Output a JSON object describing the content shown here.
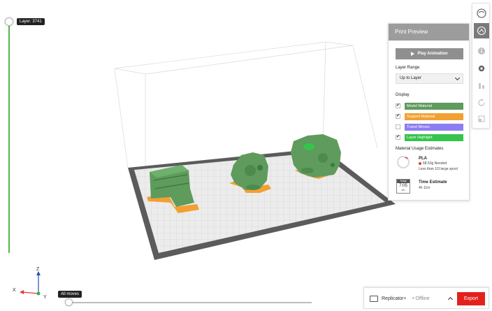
{
  "layer_slider": {
    "tooltip": "Layer: 3741"
  },
  "moves_slider": {
    "tooltip": "All moves"
  },
  "axes": {
    "x": "X",
    "y": "Y",
    "z": "Z"
  },
  "toolbar": {
    "icons": [
      "view-cube-icon",
      "print-preview-icon",
      "info-icon",
      "settings-gear-icon",
      "supports-icon",
      "refresh-icon",
      "layout-icon"
    ]
  },
  "panel": {
    "title": "Print Preview",
    "play_label": "Play Animation",
    "layer_range_title": "Layer Range",
    "layer_range_value": "Up to Layer",
    "display_title": "Display",
    "display_items": [
      {
        "label": "Model Material",
        "checked": "✔",
        "color": "#5e9b5c"
      },
      {
        "label": "Support Material",
        "checked": "✔",
        "color": "#f2a032"
      },
      {
        "label": "Travel Moves",
        "checked": "",
        "color": "#8c7ef0"
      },
      {
        "label": "Layer Highlight",
        "checked": "✔",
        "color": "#35c44c"
      }
    ],
    "material_title": "Material Usage Estimates",
    "material_name": "PLA",
    "material_needed": "68.53g  Needed",
    "material_note": "Less than 1/3 large spool",
    "calendar_header": "Today",
    "calendar_time": "7:05",
    "calendar_ampm": "am",
    "time_title": "Time Estimate",
    "time_value": "4h 11m"
  },
  "bottom_bar": {
    "printer_name": "Replicator+",
    "printer_status": "• Offline",
    "export_label": "Export"
  },
  "colors": {
    "model": "#5e9b5c",
    "support": "#f2a032",
    "travel": "#8c7ef0",
    "highlight": "#35c44c",
    "accent_red": "#e3211c"
  }
}
